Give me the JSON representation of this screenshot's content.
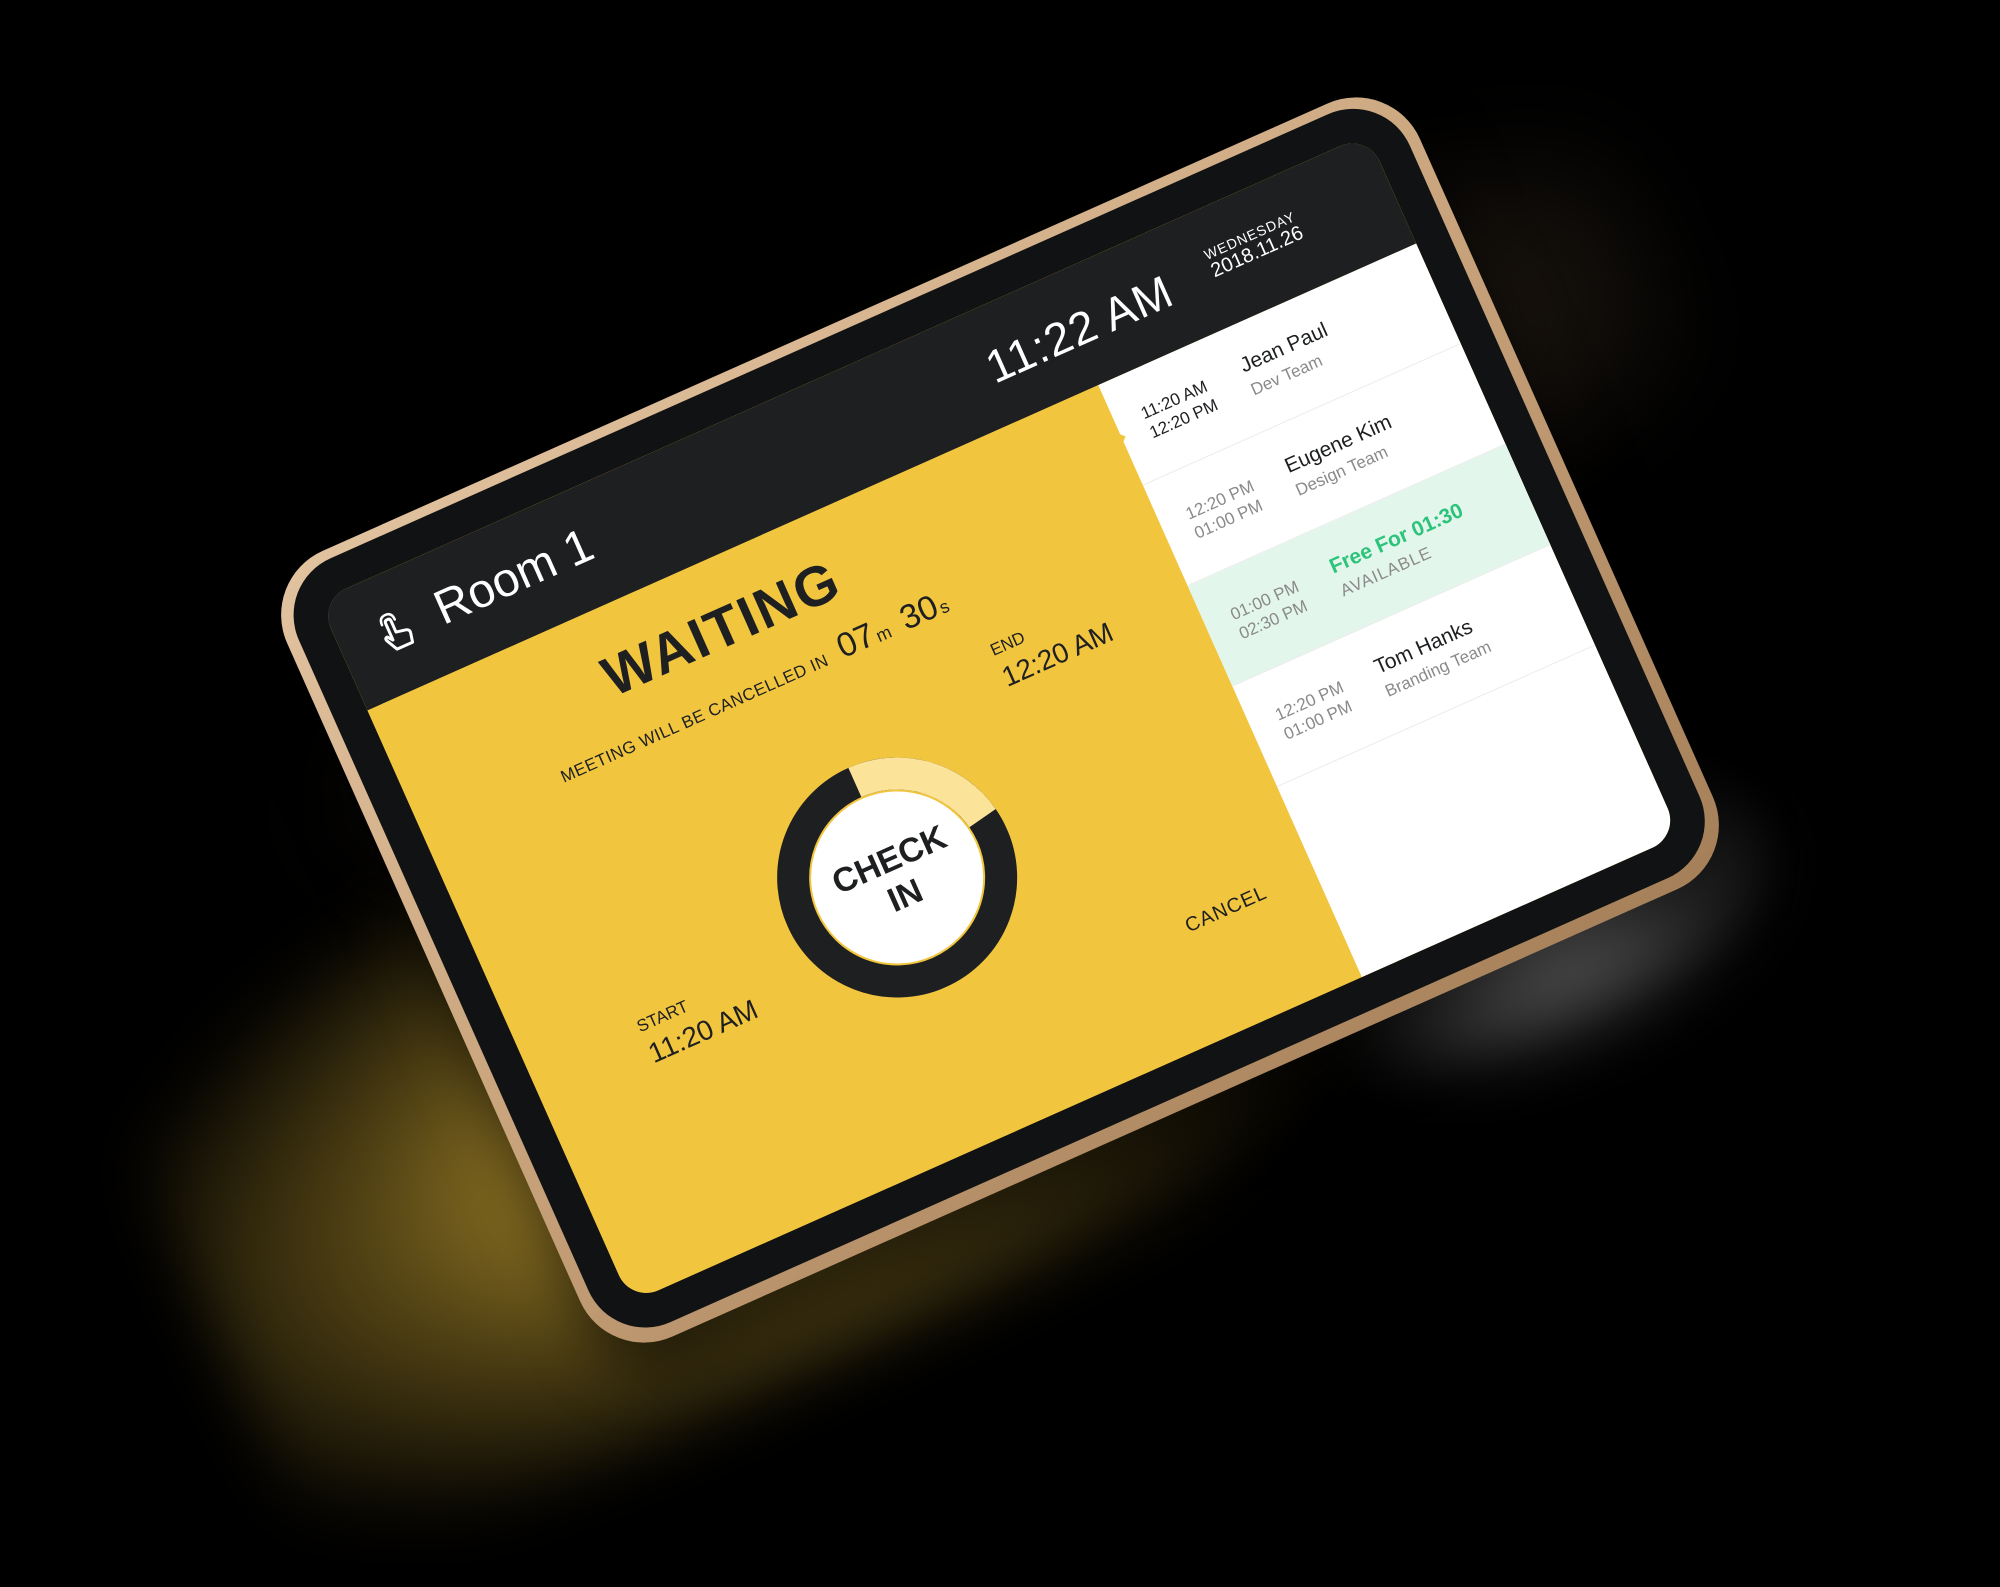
{
  "header": {
    "room_name": "Room 1",
    "clock": "11:22 AM",
    "weekday": "WEDNESDAY",
    "date": "2018.11.26"
  },
  "booking": {
    "status": "WAITING",
    "countdown_label": "MEETING WILL BE CANCELLED IN",
    "countdown_minutes": "07",
    "minutes_unit": "m",
    "countdown_seconds": "30",
    "seconds_unit": "s",
    "start_label": "START",
    "start_time": "11:20 AM",
    "end_label": "END",
    "end_time": "12:20 AM",
    "checkin_label": "CHECK\nIN",
    "cancel_label": "CANCEL",
    "progress_fraction": 0.22
  },
  "schedule": {
    "items": [
      {
        "start": "11:20 AM",
        "end": "12:20 PM",
        "title": "Jean Paul",
        "subtitle": "Dev Team"
      },
      {
        "start": "12:20 PM",
        "end": "01:00 PM",
        "title": "Eugene Kim",
        "subtitle": "Design Team"
      },
      {
        "start": "01:00 PM",
        "end": "02:30 PM",
        "title": "Free For 01:30",
        "subtitle": "AVAILABLE"
      },
      {
        "start": "12:20 PM",
        "end": "01:00 PM",
        "title": "Tom Hanks",
        "subtitle": "Branding Team"
      }
    ]
  },
  "colors": {
    "accent_yellow": "#f2c53f",
    "dark": "#1d1f21",
    "free_green": "#2cc37a",
    "free_bg": "#e3f6ec",
    "ring_progress": "#fbe39a"
  },
  "icons": {
    "room": "hand-pointer-icon"
  }
}
